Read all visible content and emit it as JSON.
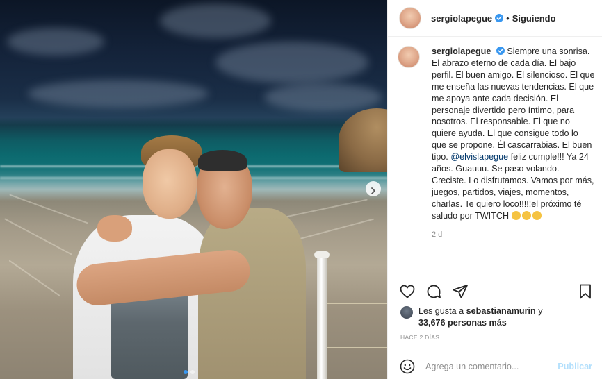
{
  "post": {
    "username": "sergiolapegue",
    "separator": "•",
    "follow_state": "Siguiendo",
    "caption_part1": "Siempre una sonrisa. El abrazo eterno de cada día. El bajo perfil. El buen amigo. El silencioso. El que me enseña las nuevas tendencias. El que me apoya ante cada decisión. El personaje divertido pero íntimo, para nosotros. El responsable. El que no quiere ayuda. El que consigue todo lo que se propone. Él cascarrabias. El buen tipo. ",
    "mention": "@elvislapegue",
    "caption_part2": " feliz cumple!!! Ya 24 años. Guauuu. Se paso volando. Creciste. Lo disfrutamos. Vamos por más, juegos, partidos, viajes, momentos, charlas. Te quiero loco!!!!!el próximo té saludo por TWITCH ",
    "caption_emojis": [
      "rolling-on-floor-laughing",
      "rolling-on-floor-laughing",
      "rolling-on-floor-laughing"
    ],
    "comment_age": "2 d",
    "likes": {
      "prefix": "Les gusta a ",
      "first_user": "sebastianamurin",
      "connector": " y",
      "count": "33,676 personas más"
    },
    "time_ago": "HACE 2 DÍAS",
    "comment_placeholder": "Agrega un comentario...",
    "publish_label": "Publicar"
  },
  "carousel": {
    "total": 2,
    "current": 1,
    "next_icon": "chevron-right-icon"
  },
  "icons": {
    "like": "heart-icon",
    "comment": "comment-icon",
    "share": "paper-plane-icon",
    "save": "bookmark-icon",
    "emoji": "smiley-icon",
    "verified": "verified-badge-icon"
  },
  "colors": {
    "link": "#00376b",
    "verified": "#3897f0",
    "publish_disabled": "#b2dffc",
    "muted": "#8e8e8e"
  }
}
